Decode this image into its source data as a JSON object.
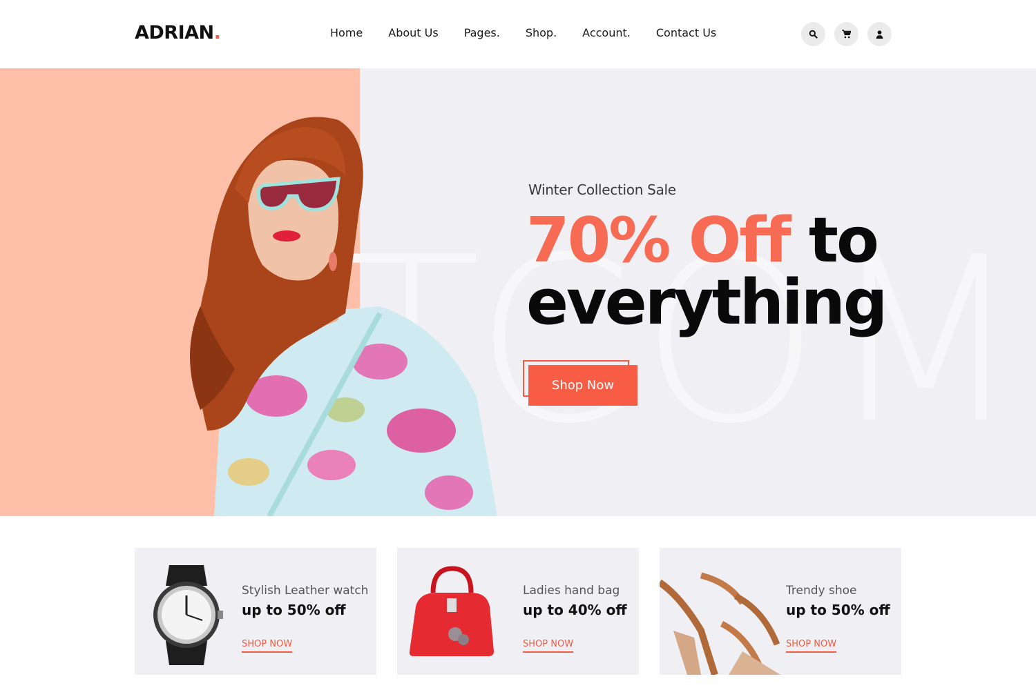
{
  "brand": {
    "name": "ADRIAN",
    "dot": "."
  },
  "nav": [
    {
      "label": "Home"
    },
    {
      "label": "About Us"
    },
    {
      "label": "Pages."
    },
    {
      "label": "Shop."
    },
    {
      "label": "Account."
    },
    {
      "label": "Contact Us"
    }
  ],
  "header_icons": [
    "search-icon",
    "cart-icon",
    "user-icon"
  ],
  "hero": {
    "subtitle": "Winter Collection Sale",
    "headline_accent": "70% Off",
    "headline_rest_1": "to",
    "headline_rest_2": "everything",
    "watermark": "TCOM",
    "button_label": "Shop Now"
  },
  "cards": [
    {
      "title": "Stylish Leather watch",
      "deal": "up to 50% off",
      "link": "SHOP NOW",
      "image": "watch"
    },
    {
      "title": "Ladies hand bag",
      "deal": "up to 40% off",
      "link": "SHOP NOW",
      "image": "handbag"
    },
    {
      "title": "Trendy shoe",
      "deal": "up to 50% off",
      "link": "SHOP NOW",
      "image": "sandal"
    }
  ],
  "colors": {
    "accent": "#f75d45",
    "hero_left_bg": "#fdbfa8",
    "hero_bg": "#f0f0f4",
    "card_bg": "#f0f0f4"
  }
}
